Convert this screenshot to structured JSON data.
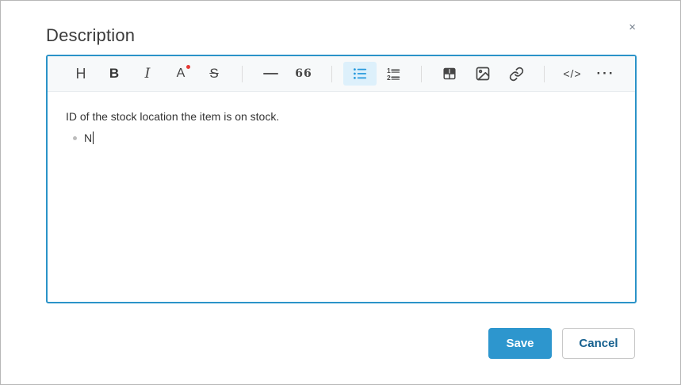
{
  "dialog": {
    "title": "Description",
    "close_glyph": "×"
  },
  "toolbar": {
    "items": [
      {
        "name": "heading",
        "label": "H"
      },
      {
        "name": "bold",
        "label": "B"
      },
      {
        "name": "italic",
        "label": "I"
      },
      {
        "name": "font-color",
        "label": "A"
      },
      {
        "name": "strikethrough",
        "label": "S"
      },
      {
        "name": "horizontal-rule",
        "label": ""
      },
      {
        "name": "blockquote",
        "label": "66"
      },
      {
        "name": "bullet-list",
        "label": "",
        "active": true
      },
      {
        "name": "numbered-list",
        "num1": "1",
        "num2": "2"
      },
      {
        "name": "table",
        "label": ""
      },
      {
        "name": "image",
        "label": ""
      },
      {
        "name": "link",
        "label": ""
      },
      {
        "name": "code",
        "label": "</>"
      },
      {
        "name": "more",
        "label": "···"
      }
    ]
  },
  "editor": {
    "paragraph": "ID of the stock location the item is on stock.",
    "list_items": [
      "N"
    ]
  },
  "footer": {
    "save_label": "Save",
    "cancel_label": "Cancel"
  },
  "colors": {
    "accent_blue_border": "#2b93c8",
    "save_button_blue": "#2d96ce",
    "active_tool_icon_blue": "#2699dd",
    "active_tool_bg": "#ddf0fb",
    "cancel_text_blue": "#17618f",
    "font_color_dot_red": "#e53935",
    "bullet_gray": "#bcbcbc"
  }
}
